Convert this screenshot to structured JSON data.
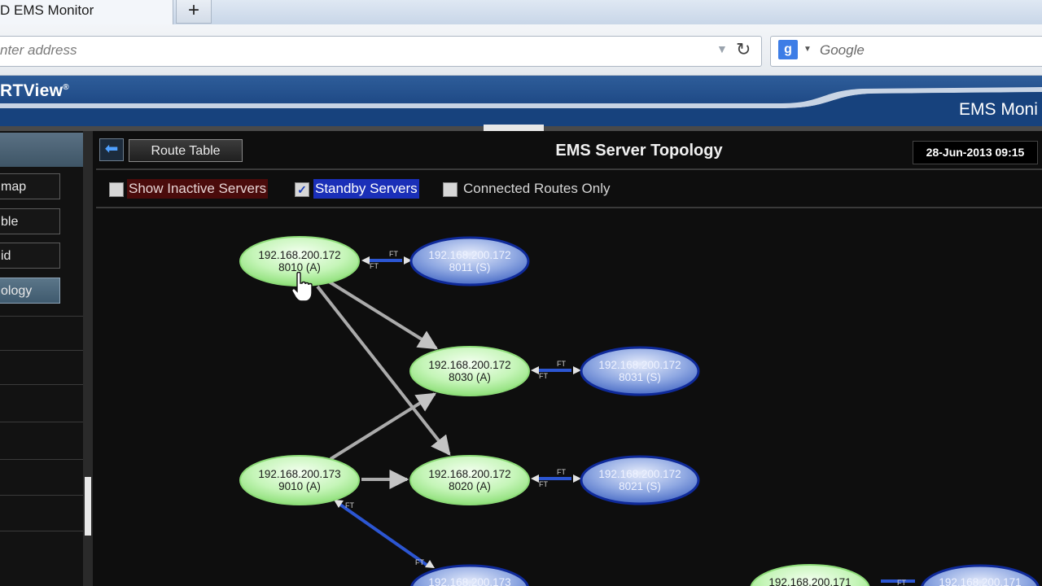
{
  "browser": {
    "tab_title": "D EMS Monitor",
    "new_tab_icon": "+",
    "address_placeholder": "nter address",
    "search_placeholder": "Google",
    "search_engine_icon": "g-icon"
  },
  "header": {
    "brand": "RTView",
    "brand_mark": "®",
    "app_title": "EMS Moni"
  },
  "leftnav": {
    "items": [
      {
        "label": "map"
      },
      {
        "label": "ble"
      },
      {
        "label": "id"
      },
      {
        "label": "ology",
        "selected": true
      }
    ]
  },
  "toolbar": {
    "back_icon": "back-arrow-icon",
    "route_table_label": "Route Table",
    "title": "EMS Server Topology",
    "datetime": "28-Jun-2013 09:15"
  },
  "filters": {
    "show_inactive": {
      "label": "Show Inactive Servers",
      "checked": false
    },
    "standby": {
      "label": "Standby Servers",
      "checked": true
    },
    "connected_only": {
      "label": "Connected Routes Only",
      "checked": false
    }
  },
  "topology": {
    "colors": {
      "active": "#b6f3a8",
      "standby": "#6f8fd6",
      "edge": "#a9a9a9",
      "ft_link": "#2c56d2"
    },
    "nodes": [
      {
        "id": "n8010",
        "line1": "192.168.200.172",
        "line2": "8010 (A)",
        "kind": "active"
      },
      {
        "id": "n8011",
        "line1": "192.168.200.172",
        "line2": "8011 (S)",
        "kind": "standby"
      },
      {
        "id": "n8030",
        "line1": "192.168.200.172",
        "line2": "8030 (A)",
        "kind": "active"
      },
      {
        "id": "n8031",
        "line1": "192.168.200.172",
        "line2": "8031 (S)",
        "kind": "standby"
      },
      {
        "id": "n9010",
        "line1": "192.168.200.173",
        "line2": "9010 (A)",
        "kind": "active"
      },
      {
        "id": "n8020",
        "line1": "192.168.200.172",
        "line2": "8020 (A)",
        "kind": "active"
      },
      {
        "id": "n8021",
        "line1": "192.168.200.172",
        "line2": "8021 (S)",
        "kind": "standby"
      },
      {
        "id": "n9011",
        "line1": "192.168.200.173",
        "line2": "",
        "kind": "standby"
      },
      {
        "id": "n171a",
        "line1": "192.168.200.171",
        "line2": "",
        "kind": "active"
      },
      {
        "id": "n171s",
        "line1": "192.168.200.171",
        "line2": "",
        "kind": "standby"
      }
    ],
    "ft_label": "FT"
  }
}
